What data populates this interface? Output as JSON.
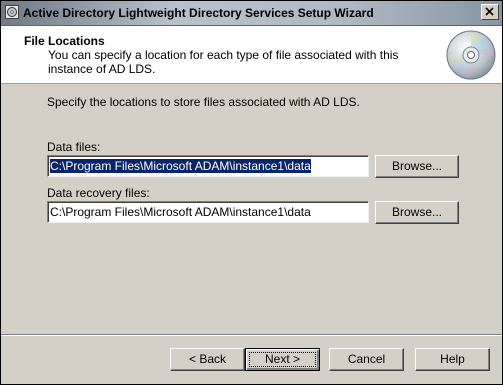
{
  "window": {
    "title": "Active Directory Lightweight Directory Services Setup Wizard"
  },
  "header": {
    "title": "File Locations",
    "description": "You can specify a location for each type of file associated with this instance of AD LDS."
  },
  "main": {
    "instructions": "Specify the locations to store files associated with AD LDS.",
    "data_files": {
      "label": "Data files:",
      "value": "C:\\Program Files\\Microsoft ADAM\\instance1\\data",
      "browse_label": "Browse..."
    },
    "data_recovery_files": {
      "label": "Data recovery files:",
      "value": "C:\\Program Files\\Microsoft ADAM\\instance1\\data",
      "browse_label": "Browse..."
    }
  },
  "footer": {
    "back_label": "< Back",
    "next_label": "Next >",
    "cancel_label": "Cancel",
    "help_label": "Help"
  },
  "icons": {
    "title_icon": "setup-disc-icon",
    "header_icon": "cd-disc-icon"
  },
  "colors": {
    "selection_highlight": "#0a246a",
    "dialog_background": "#d4d0c8"
  }
}
